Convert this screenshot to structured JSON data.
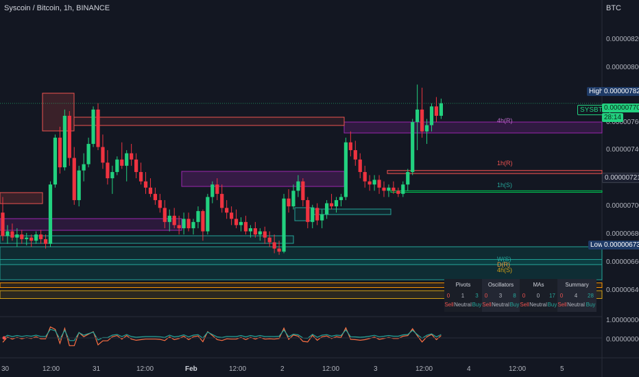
{
  "header": {
    "title": "Syscoin / Bitcoin, 1h, BINANCE",
    "currency": "BTC"
  },
  "price_axis": {
    "ticks": [
      "0.00000820",
      "0.00000800",
      "0.00000780",
      "0.00000760",
      "0.00000740",
      "0.00000720",
      "0.00000700",
      "0.00000680",
      "0.00000660",
      "0.00000640"
    ],
    "high_label": "High",
    "high_value": "0.00000782",
    "symbol_label": "SYSBTC",
    "current_price": "0.00000770",
    "countdown": "28:14",
    "marker_value": "0.00000721",
    "low_label": "Low",
    "low_value": "0.00000673"
  },
  "osc_axis": {
    "ticks": [
      "1.00000000",
      "0.00000000"
    ]
  },
  "time_axis": {
    "labels": [
      "30",
      "12:00",
      "31",
      "12:00",
      "Feb",
      "12:00",
      "2",
      "12:00",
      "3",
      "12:00",
      "4",
      "12:00",
      "5"
    ]
  },
  "zone_labels": {
    "h4_r": "4h(R)",
    "h1_r": "1h(R)",
    "h1_s": "1h(S)",
    "w_s": "W(S)",
    "d_r": "D(R)",
    "h4_s": "4h(S)"
  },
  "signals_table": {
    "groups": [
      {
        "name": "Pivots",
        "sell": "0",
        "neutral": "1",
        "buy": "3"
      },
      {
        "name": "Oscillators",
        "sell": "0",
        "neutral": "3",
        "buy": "8"
      },
      {
        "name": "MAs",
        "sell": "0",
        "neutral": "0",
        "buy": "17"
      },
      {
        "name": "Summary",
        "sell": "0",
        "neutral": "4",
        "buy": "28"
      }
    ],
    "sell_label": "Sell",
    "neutral_label": "Neutral",
    "buy_label": "Buy"
  },
  "colors": {
    "background": "#131722",
    "up": "#26a69a",
    "up_bright": "#22d17f",
    "down": "#ef3340",
    "resistance": "#ef5350",
    "purple": "#9c27b0",
    "support": "#00c853",
    "orange": "#ff9800",
    "high_tag": "#1e3a66",
    "low_tag": "#1e3a66"
  },
  "chart_data": {
    "type": "candlestick",
    "symbol": "SYSBTC",
    "interval": "1h",
    "ylim": [
      6.36e-06,
      8.3e-06
    ],
    "high": 7.82e-06,
    "low": 6.73e-06,
    "last": 7.7e-06,
    "candles": [
      [
        7e-06,
        7.1e-06,
        6.82e-06,
        6.85e-06
      ],
      [
        6.85e-06,
        6.92e-06,
        6.8e-06,
        6.88e-06
      ],
      [
        6.88e-06,
        6.93e-06,
        6.82e-06,
        6.84e-06
      ],
      [
        6.84e-06,
        6.9e-06,
        6.78e-06,
        6.86e-06
      ],
      [
        6.86e-06,
        6.89e-06,
        6.8e-06,
        6.83e-06
      ],
      [
        6.83e-06,
        6.87e-06,
        6.79e-06,
        6.84e-06
      ],
      [
        6.84e-06,
        6.86e-06,
        6.78e-06,
        6.82e-06
      ],
      [
        6.82e-06,
        6.88e-06,
        6.8e-06,
        6.86e-06
      ],
      [
        6.86e-06,
        6.89e-06,
        6.8e-06,
        6.83e-06
      ],
      [
        6.83e-06,
        6.86e-06,
        6.77e-06,
        6.8e-06
      ],
      [
        6.8e-06,
        7.2e-06,
        6.78e-06,
        7.18e-06
      ],
      [
        7.18e-06,
        7.5e-06,
        7.16e-06,
        7.48e-06
      ],
      [
        7.48e-06,
        7.55e-06,
        7.25e-06,
        7.29e-06
      ],
      [
        7.29e-06,
        7.66e-06,
        7.27e-06,
        7.62e-06
      ],
      [
        7.62e-06,
        7.65e-06,
        7.3e-06,
        7.35e-06
      ],
      [
        7.35e-06,
        7.42e-06,
        7.05e-06,
        7.08e-06
      ],
      [
        7.08e-06,
        7.3e-06,
        7.04e-06,
        7.27e-06
      ],
      [
        7.27e-06,
        7.38e-06,
        7.2e-06,
        7.31e-06
      ],
      [
        7.31e-06,
        7.48e-06,
        7.29e-06,
        7.44e-06
      ],
      [
        7.44e-06,
        7.68e-06,
        7.42e-06,
        7.66e-06
      ],
      [
        7.66e-06,
        7.7e-06,
        7.4e-06,
        7.42e-06
      ],
      [
        7.42e-06,
        7.5e-06,
        7.28e-06,
        7.32e-06
      ],
      [
        7.32e-06,
        7.4e-06,
        7.18e-06,
        7.22e-06
      ],
      [
        7.22e-06,
        7.3e-06,
        7.12e-06,
        7.26e-06
      ],
      [
        7.26e-06,
        7.36e-06,
        7.24e-06,
        7.34e-06
      ],
      [
        7.34e-06,
        7.45e-06,
        7.28e-06,
        7.3e-06
      ],
      [
        7.3e-06,
        7.4e-06,
        7.2e-06,
        7.38e-06
      ],
      [
        7.38e-06,
        7.44e-06,
        7.3e-06,
        7.34e-06
      ],
      [
        7.34e-06,
        7.38e-06,
        7.22e-06,
        7.26e-06
      ],
      [
        7.26e-06,
        7.32e-06,
        7.18e-06,
        7.2e-06
      ],
      [
        7.2e-06,
        7.26e-06,
        7.12e-06,
        7.16e-06
      ],
      [
        7.16e-06,
        7.22e-06,
        7.1e-06,
        7.12e-06
      ],
      [
        7.12e-06,
        7.16e-06,
        7.05e-06,
        7.08e-06
      ],
      [
        7.08e-06,
        7.12e-06,
        7e-06,
        7.03e-06
      ],
      [
        7.03e-06,
        7.08e-06,
        6.9e-06,
        6.94e-06
      ],
      [
        6.94e-06,
        7.02e-06,
        6.88e-06,
        6.98e-06
      ],
      [
        6.98e-06,
        7.03e-06,
        6.9e-06,
        6.92e-06
      ],
      [
        6.92e-06,
        6.98e-06,
        6.86e-06,
        6.9e-06
      ],
      [
        6.9e-06,
        7e-06,
        6.86e-06,
        6.96e-06
      ],
      [
        6.96e-06,
        7e-06,
        6.88e-06,
        6.9e-06
      ],
      [
        6.9e-06,
        6.96e-06,
        6.86e-06,
        6.94e-06
      ],
      [
        6.94e-06,
        7.04e-06,
        6.9e-06,
        7.01e-06
      ],
      [
        7.01e-06,
        7.02e-06,
        6.82e-06,
        6.88e-06
      ],
      [
        6.88e-06,
        7.12e-06,
        6.86e-06,
        7.1e-06
      ],
      [
        7.1e-06,
        7.2e-06,
        7.06e-06,
        7.18e-06
      ],
      [
        7.18e-06,
        7.22e-06,
        7.08e-06,
        7.12e-06
      ],
      [
        7.12e-06,
        7.18e-06,
        7e-06,
        7.03e-06
      ],
      [
        7.03e-06,
        7.08e-06,
        6.96e-06,
        7e-06
      ],
      [
        7e-06,
        7.04e-06,
        6.92e-06,
        6.96e-06
      ],
      [
        6.96e-06,
        7.02e-06,
        6.9e-06,
        6.92e-06
      ],
      [
        6.92e-06,
        6.97e-06,
        6.88e-06,
        6.94e-06
      ],
      [
        6.94e-06,
        6.98e-06,
        6.86e-06,
        6.88e-06
      ],
      [
        6.88e-06,
        6.92e-06,
        6.84e-06,
        6.9e-06
      ],
      [
        6.9e-06,
        6.94e-06,
        6.84e-06,
        6.86e-06
      ],
      [
        6.86e-06,
        6.9e-06,
        6.82e-06,
        6.88e-06
      ],
      [
        6.88e-06,
        6.91e-06,
        6.8e-06,
        6.84e-06
      ],
      [
        6.84e-06,
        6.88e-06,
        6.78e-06,
        6.81e-06
      ],
      [
        6.81e-06,
        6.86e-06,
        6.74e-06,
        6.77e-06
      ],
      [
        6.77e-06,
        6.82e-06,
        6.73e-06,
        6.75e-06
      ],
      [
        6.75e-06,
        7.12e-06,
        6.74e-06,
        7.09e-06
      ],
      [
        7.09e-06,
        7.15e-06,
        7e-06,
        7.04e-06
      ],
      [
        7.04e-06,
        7.18e-06,
        7.02e-06,
        7.14e-06
      ],
      [
        7.14e-06,
        7.24e-06,
        7.1e-06,
        7.2e-06
      ],
      [
        7.2e-06,
        7.22e-06,
        7.04e-06,
        7.08e-06
      ],
      [
        7.08e-06,
        7.1e-06,
        6.9e-06,
        6.94e-06
      ],
      [
        6.94e-06,
        7.05e-06,
        6.9e-06,
        7.03e-06
      ],
      [
        7.03e-06,
        7.06e-06,
        6.92e-06,
        6.95e-06
      ],
      [
        6.95e-06,
        7.02e-06,
        6.9e-06,
        6.99e-06
      ],
      [
        6.99e-06,
        7.08e-06,
        6.96e-06,
        7.06e-06
      ],
      [
        7.06e-06,
        7.12e-06,
        7.02e-06,
        7.04e-06
      ],
      [
        7.04e-06,
        7.1e-06,
        7e-06,
        7.08e-06
      ],
      [
        7.08e-06,
        7.12e-06,
        7.04e-06,
        7.1e-06
      ],
      [
        7.1e-06,
        7.48e-06,
        7.08e-06,
        7.45e-06
      ],
      [
        7.45e-06,
        7.52e-06,
        7.36e-06,
        7.4e-06
      ],
      [
        7.4e-06,
        7.46e-06,
        7.3e-06,
        7.34e-06
      ],
      [
        7.34e-06,
        7.38e-06,
        7.22e-06,
        7.26e-06
      ],
      [
        7.26e-06,
        7.3e-06,
        7.16e-06,
        7.2e-06
      ],
      [
        7.2e-06,
        7.24e-06,
        7.14e-06,
        7.18e-06
      ],
      [
        7.18e-06,
        7.24e-06,
        7.14e-06,
        7.21e-06
      ],
      [
        7.21e-06,
        7.24e-06,
        7.12e-06,
        7.16e-06
      ],
      [
        7.16e-06,
        7.2e-06,
        7.1e-06,
        7.14e-06
      ],
      [
        7.14e-06,
        7.18e-06,
        7.1e-06,
        7.16e-06
      ],
      [
        7.16e-06,
        7.2e-06,
        7.12e-06,
        7.14e-06
      ],
      [
        7.14e-06,
        7.16e-06,
        7.1e-06,
        7.12e-06
      ],
      [
        7.12e-06,
        7.2e-06,
        7.1e-06,
        7.18e-06
      ],
      [
        7.18e-06,
        7.28e-06,
        7.14e-06,
        7.26e-06
      ],
      [
        7.26e-06,
        7.6e-06,
        7.24e-06,
        7.58e-06
      ],
      [
        7.58e-06,
        7.82e-06,
        7.4e-06,
        7.66e-06
      ],
      [
        7.66e-06,
        7.8e-06,
        7.48e-06,
        7.52e-06
      ],
      [
        7.52e-06,
        7.6e-06,
        7.44e-06,
        7.56e-06
      ],
      [
        7.56e-06,
        7.7e-06,
        7.52e-06,
        7.68e-06
      ],
      [
        7.68e-06,
        7.74e-06,
        7.58e-06,
        7.62e-06
      ],
      [
        7.62e-06,
        7.73e-06,
        7.6e-06,
        7.7e-06
      ]
    ],
    "zones": [
      {
        "label": "4h(R)",
        "bottom": 7.51e-06,
        "top": 7.58e-06
      },
      {
        "label": "1h(R)",
        "bottom": 7.25e-06,
        "top": 7.27e-06
      },
      {
        "label": "1h(S)",
        "bottom": 7.13e-06,
        "top": 7.14e-06
      },
      {
        "label": "W(S)",
        "bottom": 6.57e-06,
        "top": 6.7e-06
      },
      {
        "label": "D(R)",
        "bottom": 6.52e-06,
        "top": 6.55e-06
      },
      {
        "label": "4h(S)",
        "bottom": 6.45e-06,
        "top": 6.5e-06
      }
    ]
  }
}
